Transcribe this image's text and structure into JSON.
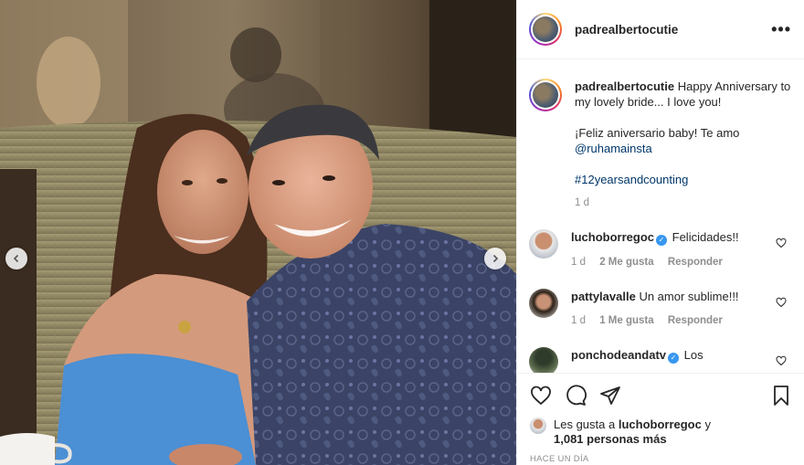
{
  "post": {
    "author": "padrealbertocutie",
    "more_icon": "ellipsis-icon"
  },
  "caption": {
    "username": "padrealbertocutie",
    "line1": "Happy Anniversary to my lovely bride... I love you!",
    "line2": "¡Feliz aniversario baby! Te amo",
    "mention": "@ruhamainsta",
    "hashtag": "#12yearsandcounting",
    "age": "1 d"
  },
  "comments": [
    {
      "username": "luchoborregoc",
      "verified": true,
      "text": "Felicidades!!",
      "age": "1 d",
      "likes": "2 Me gusta",
      "reply": "Responder"
    },
    {
      "username": "pattylavalle",
      "verified": false,
      "text": "Un amor sublime!!!",
      "age": "1 d",
      "likes": "1 Me gusta",
      "reply": "Responder"
    },
    {
      "username": "ponchodeandatv",
      "verified": true,
      "text": "Los"
    }
  ],
  "likes_line": {
    "prefix": "Les gusta a",
    "user": "luchoborregoc",
    "conj": "y",
    "others": "1,081 personas más"
  },
  "timestamp": "HACE UN DÍA",
  "colors": {
    "link": "#00376b",
    "verified": "#3897f0",
    "muted": "#8e8e8e"
  }
}
